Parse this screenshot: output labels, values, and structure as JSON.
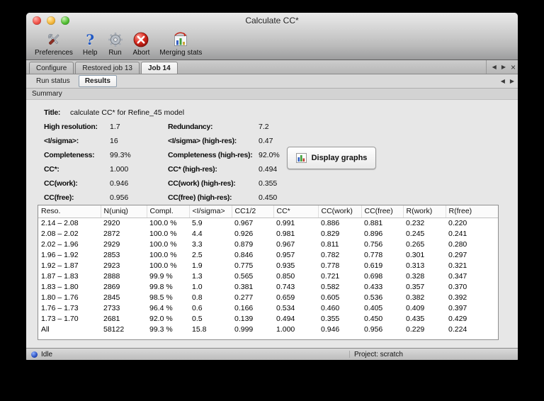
{
  "window": {
    "title": "Calculate CC*",
    "traffic_lights": [
      "close",
      "minimize",
      "zoom"
    ]
  },
  "toolbar": {
    "items": [
      {
        "label": "Preferences",
        "icon": "preferences-icon"
      },
      {
        "label": "Help",
        "icon": "help-icon"
      },
      {
        "label": "Run",
        "icon": "run-icon"
      },
      {
        "label": "Abort",
        "icon": "abort-icon"
      },
      {
        "label": "Merging stats",
        "icon": "merging-stats-icon"
      }
    ]
  },
  "job_tabs": {
    "items": [
      {
        "label": "Configure",
        "active": false
      },
      {
        "label": "Restored job 13",
        "active": false
      },
      {
        "label": "Job 14",
        "active": true
      }
    ],
    "nav": {
      "scroll_left": "◀",
      "scroll_right": "▶",
      "close": "×"
    }
  },
  "result_tabs": {
    "items": [
      {
        "label": "Run status",
        "active": false
      },
      {
        "label": "Results",
        "active": true
      }
    ],
    "nav": {
      "scroll_left": "◀",
      "scroll_right": "▶"
    }
  },
  "section": {
    "label": "Summary"
  },
  "summary": {
    "title": {
      "label": "Title:",
      "value": "calculate CC* for Refine_45 model"
    },
    "rows": [
      {
        "label1": "High resolution:",
        "value1": "1.7",
        "label2": "Redundancy:",
        "value2": "7.2"
      },
      {
        "label1": "<I/sigma>:",
        "value1": "16",
        "label2": "<I/sigma> (high-res):",
        "value2": "0.47"
      },
      {
        "label1": "Completeness:",
        "value1": "99.3%",
        "label2": "Completeness (high-res):",
        "value2": "92.0%"
      },
      {
        "label1": "CC*:",
        "value1": "1.000",
        "label2": "CC* (high-res):",
        "value2": "0.494"
      },
      {
        "label1": "CC(work):",
        "value1": "0.946",
        "label2": "CC(work) (high-res):",
        "value2": "0.355"
      },
      {
        "label1": "CC(free):",
        "value1": "0.956",
        "label2": "CC(free) (high-res):",
        "value2": "0.450"
      }
    ],
    "display_graphs": {
      "label": "Display graphs",
      "icon": "bar-chart-icon"
    }
  },
  "table": {
    "columns": [
      "Reso.",
      "N(uniq)",
      "Compl.",
      "<I/sigma>",
      "CC1/2",
      "CC*",
      "CC(work)",
      "CC(free)",
      "R(work)",
      "R(free)"
    ],
    "rows": [
      [
        "2.14 – 2.08",
        "2920",
        "100.0 %",
        "5.9",
        "0.967",
        "0.991",
        "0.886",
        "0.881",
        "0.232",
        "0.220"
      ],
      [
        "2.08 – 2.02",
        "2872",
        "100.0 %",
        "4.4",
        "0.926",
        "0.981",
        "0.829",
        "0.896",
        "0.245",
        "0.241"
      ],
      [
        "2.02 – 1.96",
        "2929",
        "100.0 %",
        "3.3",
        "0.879",
        "0.967",
        "0.811",
        "0.756",
        "0.265",
        "0.280"
      ],
      [
        "1.96 – 1.92",
        "2853",
        "100.0 %",
        "2.5",
        "0.846",
        "0.957",
        "0.782",
        "0.778",
        "0.301",
        "0.297"
      ],
      [
        "1.92 – 1.87",
        "2923",
        "100.0 %",
        "1.9",
        "0.775",
        "0.935",
        "0.778",
        "0.619",
        "0.313",
        "0.321"
      ],
      [
        "1.87 – 1.83",
        "2888",
        "99.9 %",
        "1.3",
        "0.565",
        "0.850",
        "0.721",
        "0.698",
        "0.328",
        "0.347"
      ],
      [
        "1.83 – 1.80",
        "2869",
        "99.8 %",
        "1.0",
        "0.381",
        "0.743",
        "0.582",
        "0.433",
        "0.357",
        "0.370"
      ],
      [
        "1.80 – 1.76",
        "2845",
        "98.5 %",
        "0.8",
        "0.277",
        "0.659",
        "0.605",
        "0.536",
        "0.382",
        "0.392"
      ],
      [
        "1.76 – 1.73",
        "2733",
        "96.4 %",
        "0.6",
        "0.166",
        "0.534",
        "0.460",
        "0.405",
        "0.409",
        "0.397"
      ],
      [
        "1.73 – 1.70",
        "2681",
        "92.0 %",
        "0.5",
        "0.139",
        "0.494",
        "0.355",
        "0.450",
        "0.435",
        "0.429"
      ],
      [
        "All",
        "58122",
        "99.3 %",
        "15.8",
        "0.999",
        "1.000",
        "0.946",
        "0.956",
        "0.229",
        "0.224"
      ]
    ]
  },
  "statusbar": {
    "status": "Idle",
    "project": "Project: scratch"
  },
  "colors": {
    "abort_red": "#d92a1e",
    "help_blue": "#2159c4",
    "status_idle_blue": "#2a50c0",
    "graph_bar_blue": "#2e5fc0",
    "graph_bar_green": "#3f9e3a",
    "graph_bar_red": "#c23b32"
  }
}
